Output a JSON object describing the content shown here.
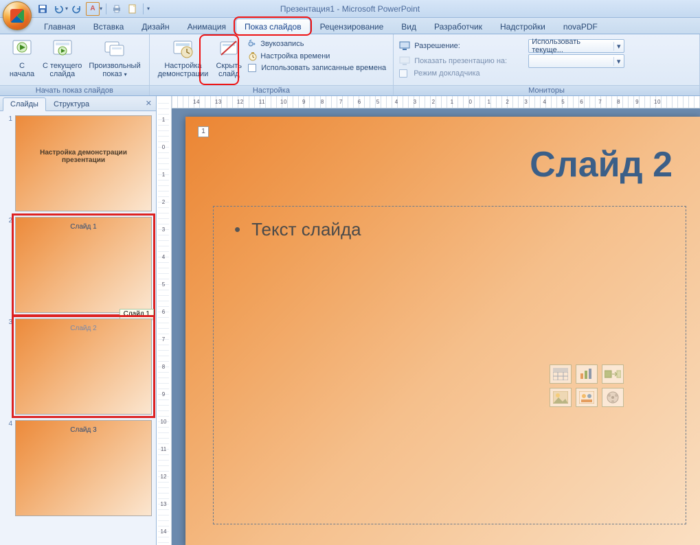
{
  "app_title": "Презентация1 - Microsoft PowerPoint",
  "qat": {
    "save": "save-icon",
    "undo": "undo-icon",
    "redo": "redo-icon",
    "repeat": "repeat-icon",
    "spell": "spell-icon",
    "print": "quick-print-icon",
    "new": "new-icon"
  },
  "tabs": [
    "Главная",
    "Вставка",
    "Дизайн",
    "Анимация",
    "Показ слайдов",
    "Рецензирование",
    "Вид",
    "Разработчик",
    "Надстройки",
    "novaPDF"
  ],
  "active_tab_index": 4,
  "ribbon": {
    "group1": {
      "caption": "Начать показ слайдов",
      "from_start": "С\nначала",
      "from_current": "С текущего\nслайда",
      "custom": "Произвольный\nпоказ"
    },
    "group2": {
      "caption": "Настройка",
      "setup": "Настройка\nдемонстрации",
      "hide": "Скрыть\nслайд",
      "record": "Звукозапись",
      "rehearse": "Настройка времени",
      "use_timings": "Использовать записанные времена"
    },
    "group3": {
      "caption": "Мониторы",
      "res_lbl": "Разрешение:",
      "res_val": "Использовать текуще...",
      "showon_lbl": "Показать презентацию на:",
      "presenter": "Режим докладчика"
    }
  },
  "side_tabs": [
    "Слайды",
    "Структура"
  ],
  "side_active": 0,
  "thumbs": [
    {
      "n": "1",
      "title": "Настройка демонстрации\nпрезентации"
    },
    {
      "n": "2",
      "title": "Слайд 1"
    },
    {
      "n": "3",
      "title": "Слайд 2"
    },
    {
      "n": "4",
      "title": "Слайд 3"
    }
  ],
  "thumb_tooltip": "Слайд 1",
  "slide": {
    "page": "1",
    "title": "Слайд 2",
    "bullet": "Текст слайда"
  },
  "ruler_h": [
    "14",
    "13",
    "12",
    "11",
    "10",
    "9",
    "8",
    "7",
    "6",
    "5",
    "4",
    "3",
    "2",
    "1",
    "0",
    "1",
    "2",
    "3",
    "4",
    "5",
    "6",
    "7",
    "8",
    "9",
    "10"
  ],
  "ruler_v": [
    "1",
    "0",
    "1",
    "2",
    "3",
    "4",
    "5",
    "6",
    "7",
    "8",
    "9",
    "10",
    "11",
    "12",
    "13",
    "14"
  ]
}
